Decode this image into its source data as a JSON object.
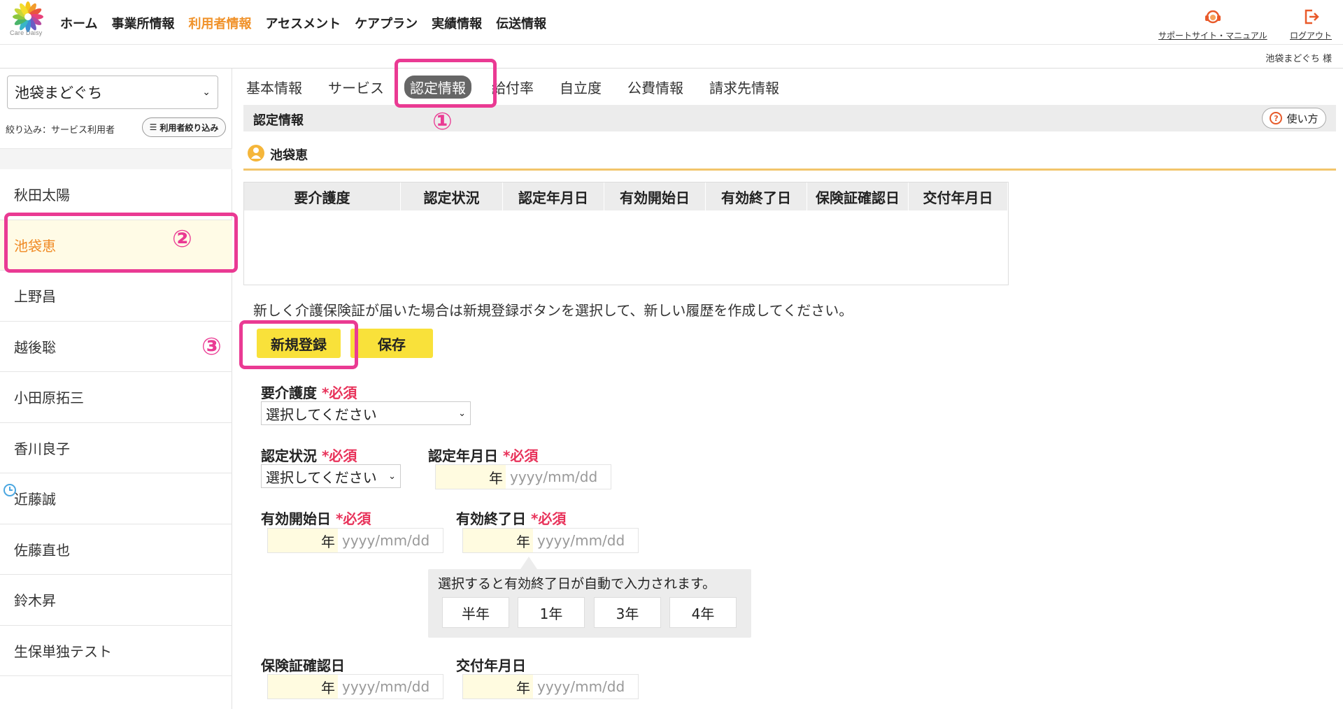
{
  "header": {
    "logo_text": "Care Daisy",
    "nav": [
      "ホーム",
      "事業所情報",
      "利用者情報",
      "アセスメント",
      "ケアプラン",
      "実績情報",
      "伝送情報"
    ],
    "active_nav": "利用者情報",
    "support_link": "サポートサイト・マニュアル",
    "logout_link": "ログアウト",
    "username": "池袋まどぐち 様"
  },
  "sidebar": {
    "office": "池袋まどぐち",
    "filter_label": "絞り込み：サービス利用者",
    "filter_button": "利用者絞り込み",
    "users": [
      "秋田太陽",
      "池袋恵",
      "上野昌",
      "越後聡",
      "小田原拓三",
      "香川良子",
      "近藤誠",
      "佐藤直也",
      "鈴木昇",
      "生保単独テスト"
    ],
    "selected_user": "池袋恵"
  },
  "tabs": [
    "基本情報",
    "サービス",
    "認定情報",
    "給付率",
    "自立度",
    "公費情報",
    "請求先情報"
  ],
  "active_tab": "認定情報",
  "section": {
    "title": "認定情報",
    "howto": "使い方",
    "person": "池袋恵"
  },
  "table": {
    "headers": [
      "要介護度",
      "認定状況",
      "認定年月日",
      "有効開始日",
      "有効終了日",
      "保険証確認日",
      "交付年月日"
    ]
  },
  "notice": "新しく介護保険証が届いた場合は新規登録ボタンを選択して、新しい履歴を作成してください。",
  "buttons": {
    "new": "新規登録",
    "save": "保存"
  },
  "form": {
    "required_mark": "*必須",
    "care_level_label": "要介護度",
    "care_level_value": "選択してください",
    "cert_status_label": "認定状況",
    "cert_status_value": "選択してください",
    "cert_date_label": "認定年月日",
    "valid_start_label": "有効開始日",
    "valid_end_label": "有効終了日",
    "insurance_check_label": "保険証確認日",
    "issue_date_label": "交付年月日",
    "year_unit": "年",
    "date_placeholder": "yyyy/mm/dd"
  },
  "tooltip": {
    "text": "選択すると有効終了日が自動で入力されます。",
    "options": [
      "半年",
      "1年",
      "3年",
      "4年"
    ]
  },
  "annotations": [
    "①",
    "②",
    "③"
  ],
  "colors": {
    "accent": "#f0922a",
    "highlight": "#ea3a93",
    "button_yellow": "#f9e13a",
    "required": "#e8325a"
  }
}
